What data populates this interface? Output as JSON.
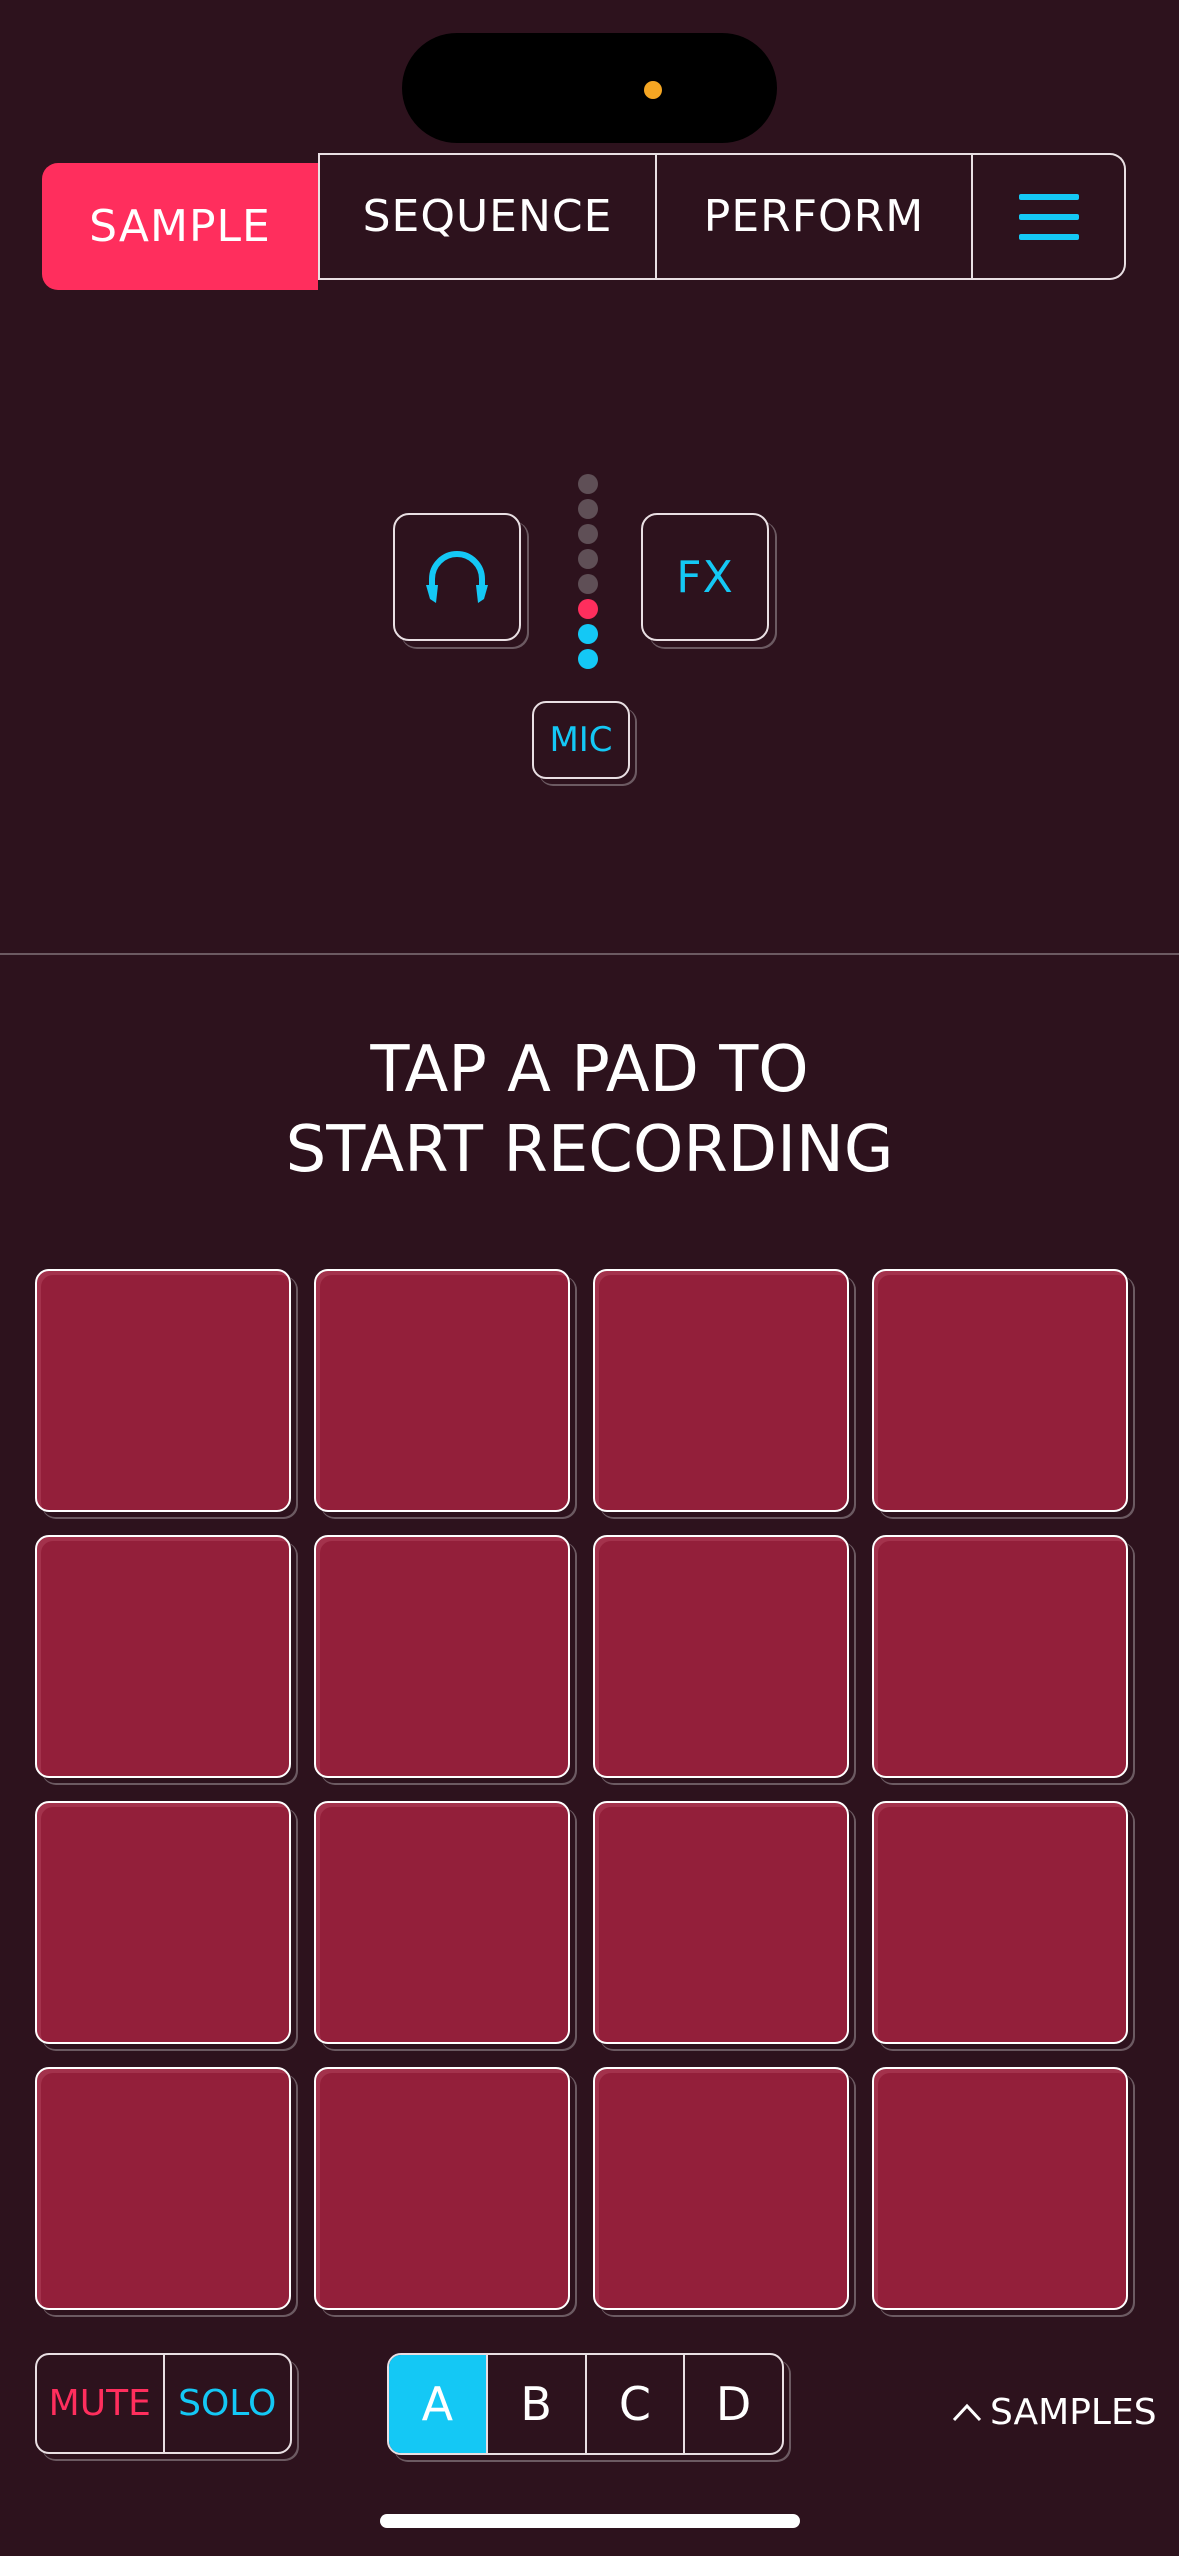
{
  "nav": {
    "tabs": [
      {
        "label": "SAMPLE",
        "active": true
      },
      {
        "label": "SEQUENCE",
        "active": false
      },
      {
        "label": "PERFORM",
        "active": false
      }
    ],
    "menu_icon": "hamburger-icon"
  },
  "monitor": {
    "headphones_icon": "headphones-icon",
    "fx_label": "FX",
    "mic_label": "MIC",
    "meter_colors": [
      "#5f4f56",
      "#5f4f56",
      "#5f4f56",
      "#5f4f56",
      "#5f4f56",
      "#ff2e5d",
      "#14c8f5",
      "#14c8f5"
    ]
  },
  "hint": {
    "line1": "TAP A PAD TO",
    "line2": "START RECORDING"
  },
  "pads": {
    "count": 16,
    "color": "#931f3a"
  },
  "footer": {
    "mute_label": "MUTE",
    "solo_label": "SOLO",
    "banks": [
      {
        "label": "A",
        "active": true
      },
      {
        "label": "B",
        "active": false
      },
      {
        "label": "C",
        "active": false
      },
      {
        "label": "D",
        "active": false
      }
    ],
    "samples_label": "SAMPLES"
  },
  "colors": {
    "background": "#2d121d",
    "accent_pink": "#ff2e5d",
    "accent_cyan": "#14c8f5",
    "pad": "#931f3a"
  }
}
